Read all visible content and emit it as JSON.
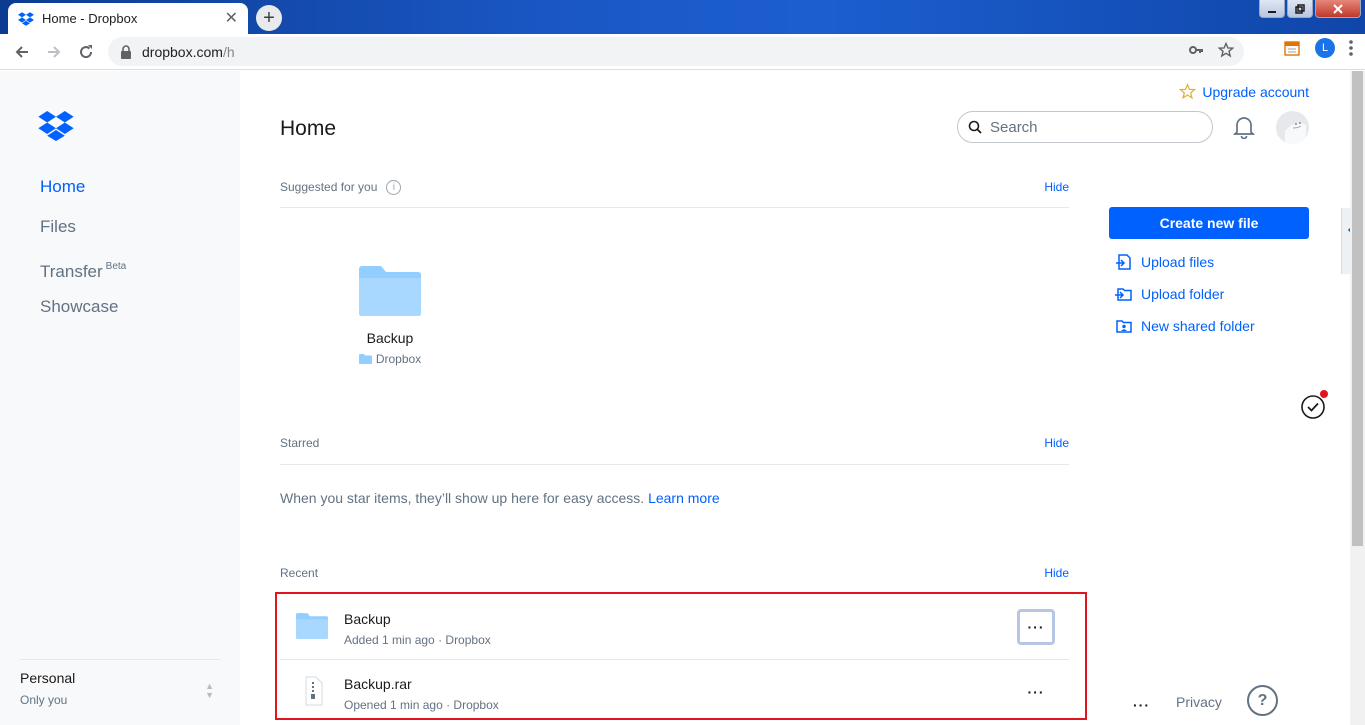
{
  "browser": {
    "tab_title": "Home - Dropbox",
    "tab_close": "✕",
    "new_tab": "+",
    "url_host": "dropbox.com",
    "url_path": "/h",
    "profile_initial": "L"
  },
  "sidebar": {
    "items": [
      {
        "label": "Home",
        "active": true
      },
      {
        "label": "Files"
      },
      {
        "label": "Transfer",
        "badge": "Beta"
      },
      {
        "label": "Showcase"
      }
    ],
    "account_name": "Personal",
    "account_sub": "Only you"
  },
  "header": {
    "upgrade_label": "Upgrade account",
    "title": "Home",
    "search_placeholder": "Search"
  },
  "suggested": {
    "heading": "Suggested for you",
    "info": "i",
    "hide": "Hide",
    "item_name": "Backup",
    "item_location": "Dropbox"
  },
  "starred": {
    "heading": "Starred",
    "hide": "Hide",
    "message": "When you star items, they’ll show up here for easy access.",
    "learn_more": "Learn more"
  },
  "recent": {
    "heading": "Recent",
    "hide": "Hide",
    "items": [
      {
        "name": "Backup",
        "meta": "Added 1 min ago · Dropbox",
        "more": "···"
      },
      {
        "name": "Backup.rar",
        "meta": "Opened 1 min ago · Dropbox",
        "more": "···"
      }
    ]
  },
  "actions": {
    "create_label": "Create new file",
    "upload_files": "Upload files",
    "upload_folder": "Upload folder",
    "new_shared_folder": "New shared folder"
  },
  "footer": {
    "more": "···",
    "privacy": "Privacy",
    "help": "?"
  },
  "colors": {
    "accent": "#0061fe",
    "folder": "#92ceff",
    "highlight": "#e0141e"
  }
}
